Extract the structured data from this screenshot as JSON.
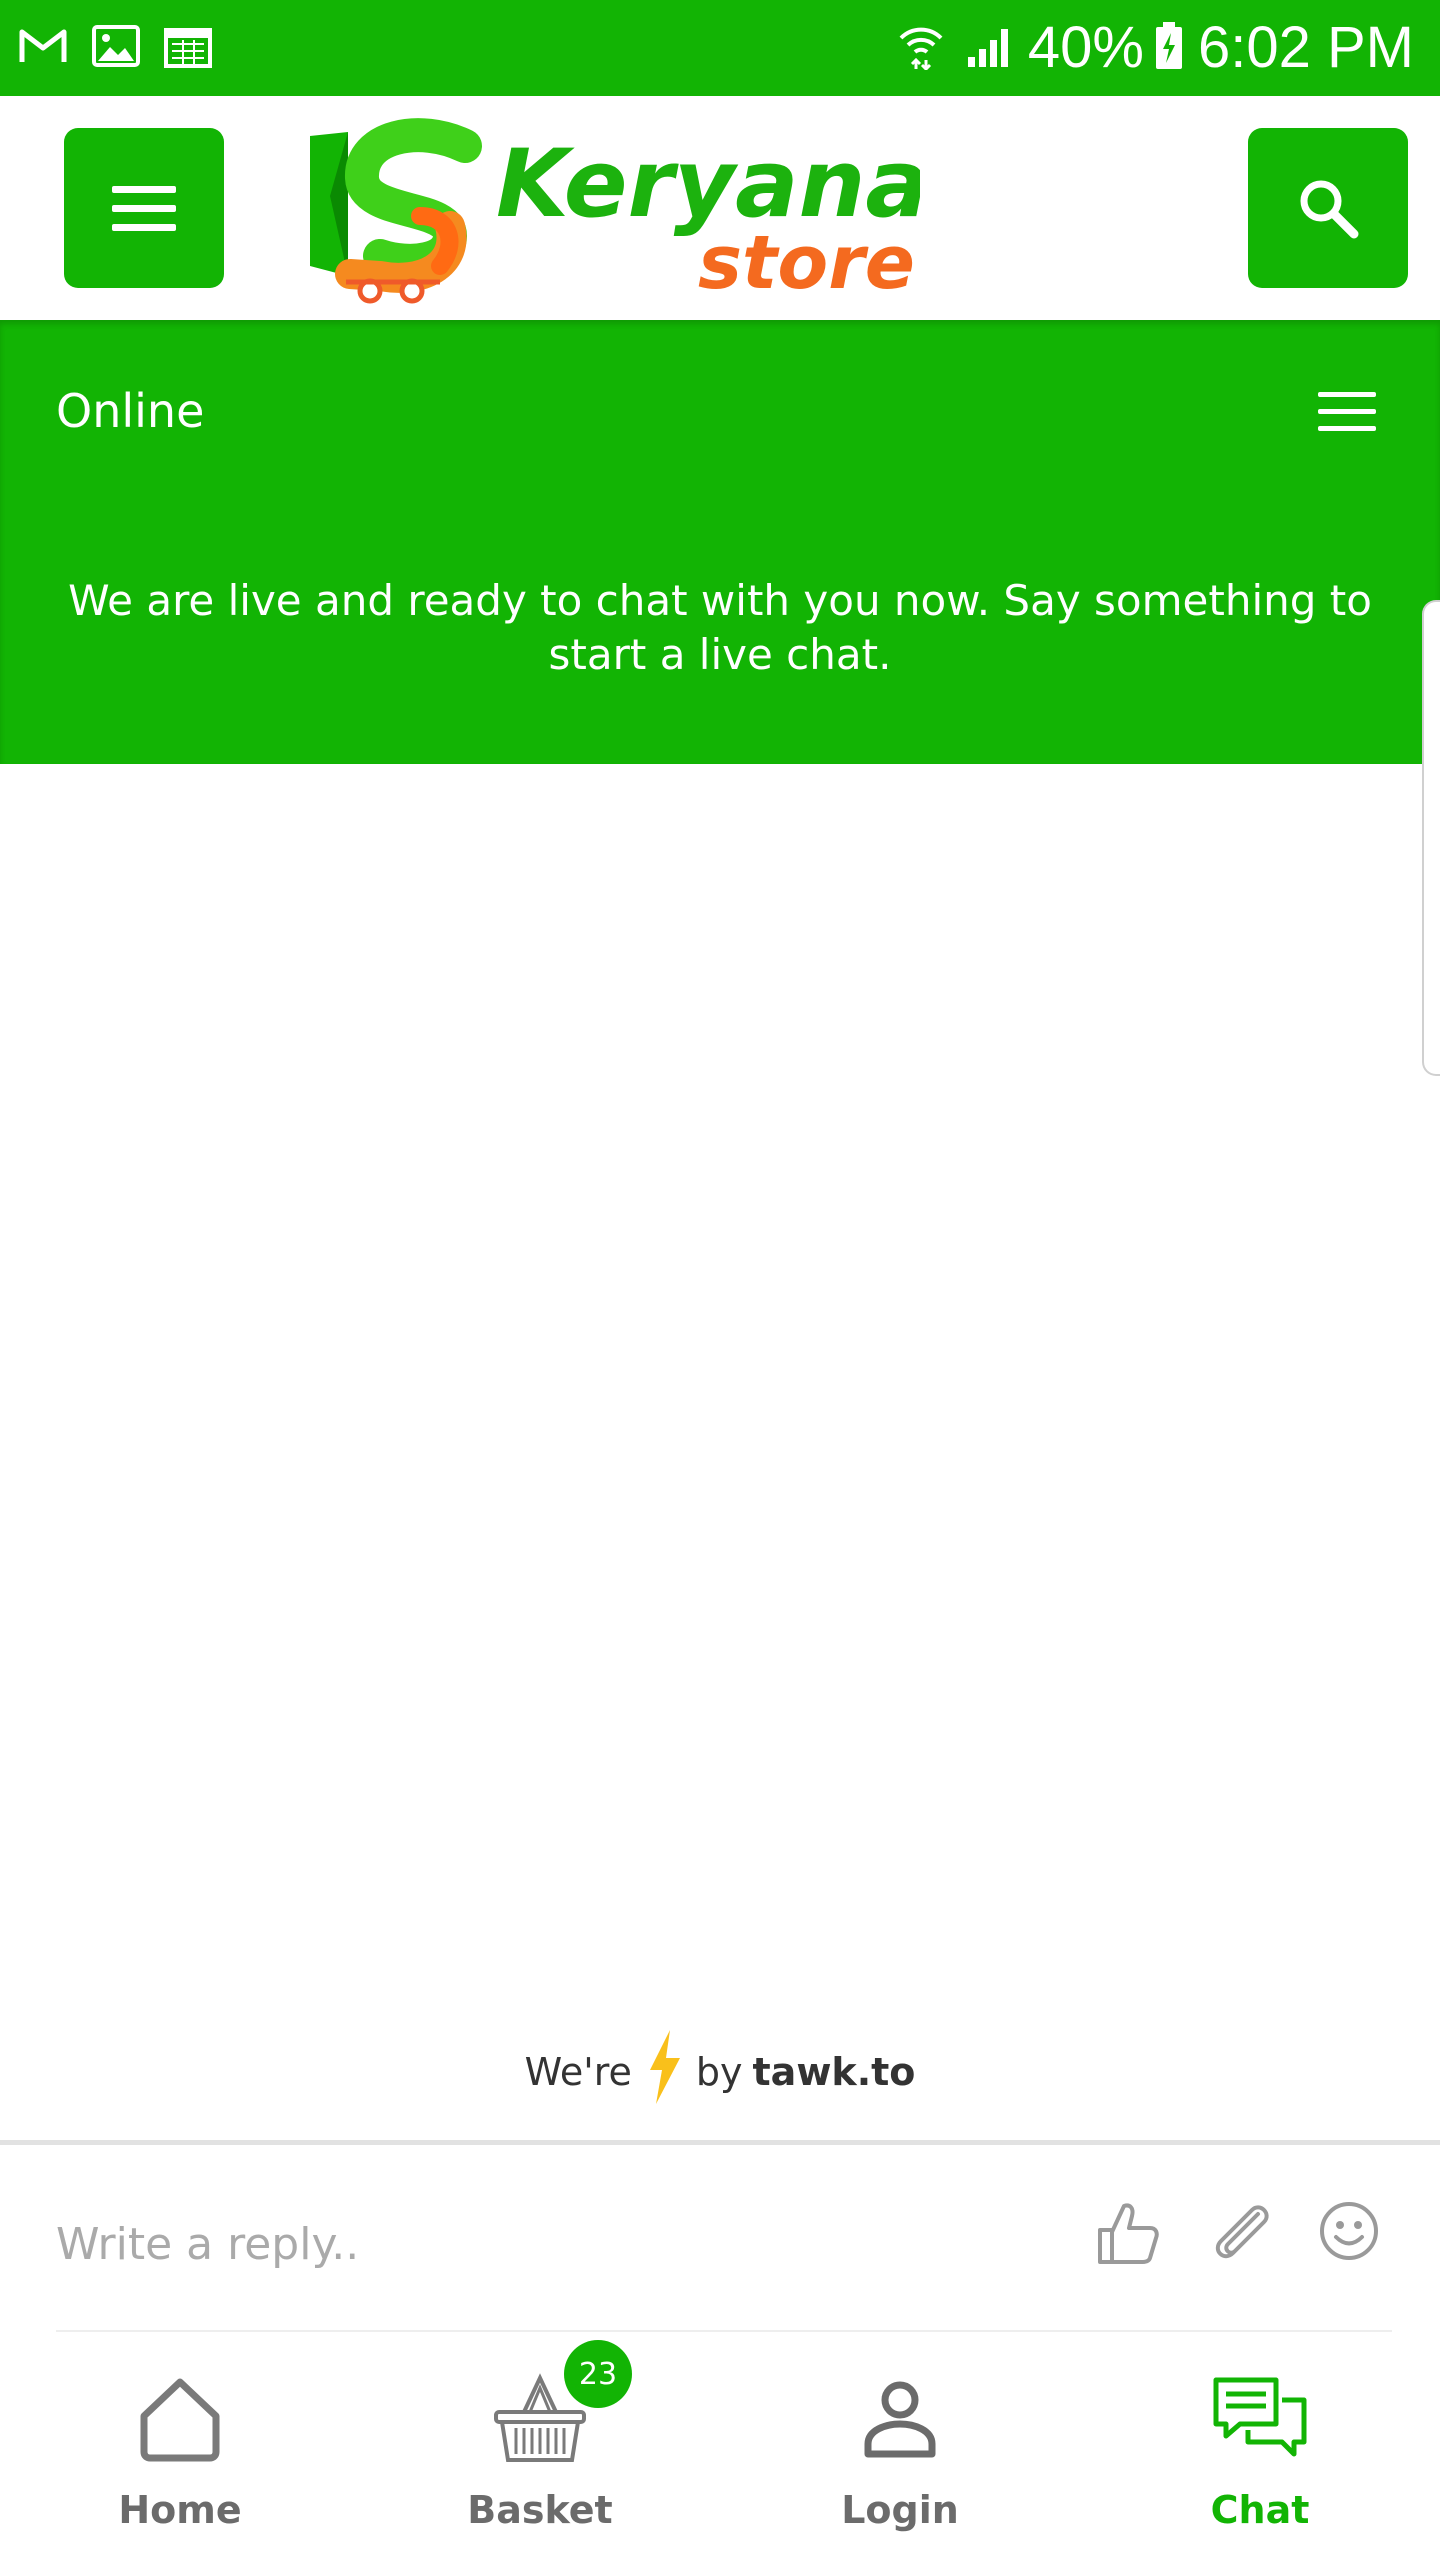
{
  "status_bar": {
    "left_icons": [
      "gmail-icon",
      "gallery-icon",
      "calendar-icon"
    ],
    "battery": "40%",
    "time": "6:02 PM"
  },
  "header": {
    "logo_word1": "Keryana",
    "logo_word2": "store",
    "colors": {
      "brand_green": "#12b404",
      "logo_orange": "#f46a1f"
    }
  },
  "chat": {
    "status": "Online",
    "welcome": "We are live and ready to chat with you now. Say something to start a live chat.",
    "powered_prefix": "We're",
    "powered_by": "by",
    "powered_brand": "tawk.to",
    "reply_placeholder": "Write a reply.."
  },
  "bottom_nav": {
    "items": [
      {
        "label": "Home",
        "icon": "home-icon",
        "active": false
      },
      {
        "label": "Basket",
        "icon": "basket-icon",
        "active": false,
        "badge": "23"
      },
      {
        "label": "Login",
        "icon": "user-icon",
        "active": false
      },
      {
        "label": "Chat",
        "icon": "chat-icon",
        "active": true
      }
    ]
  }
}
